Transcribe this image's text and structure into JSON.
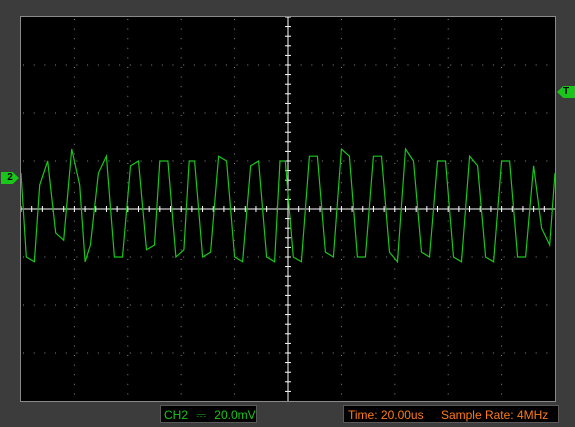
{
  "channel": {
    "marker_label": "2",
    "name": "CH2",
    "coupling_symbol": "⎓",
    "scale": "20.0mV"
  },
  "trigger": {
    "marker_label": "T"
  },
  "timebase": {
    "time_label": "Time: 20.00us",
    "sample_rate_label": "Sample Rate: 4MHz"
  },
  "colors": {
    "trace": "#19c619",
    "grid_dots": "#8a8a8a",
    "axis": "#ffffff",
    "status_orange": "#ff7a1a",
    "background": "#000000"
  },
  "grid": {
    "h_divisions": 10,
    "v_divisions": 8
  },
  "chart_data": {
    "type": "line",
    "title": "",
    "xlabel": "",
    "ylabel": "",
    "x_unit": "us",
    "y_unit": "mV",
    "xlim": [
      0,
      200
    ],
    "ylim": [
      -80,
      80
    ],
    "series": [
      {
        "x": [
          0,
          2,
          5,
          7,
          10,
          13,
          16,
          19,
          22,
          24,
          26,
          29,
          32,
          35,
          38,
          41,
          44,
          47,
          50,
          52,
          55,
          58,
          61,
          63,
          65,
          68,
          71,
          74,
          77,
          80,
          83,
          86,
          89,
          92,
          95,
          97,
          99,
          102,
          105,
          108,
          111,
          114,
          117,
          120,
          123,
          126,
          129,
          132,
          135,
          138,
          141,
          144,
          147,
          150,
          153,
          156,
          159,
          162,
          165,
          168,
          171,
          174,
          177,
          180,
          183,
          186,
          189,
          192,
          195,
          198,
          200
        ],
        "y": [
          15,
          -20,
          -22,
          10,
          20,
          -10,
          -13,
          25,
          10,
          -22,
          -15,
          15,
          22,
          -20,
          -20,
          18,
          20,
          -17,
          -15,
          20,
          20,
          -20,
          -17,
          20,
          20,
          -20,
          -18,
          22,
          20,
          -20,
          -22,
          18,
          20,
          -20,
          -22,
          20,
          20,
          -20,
          -22,
          22,
          22,
          -18,
          -20,
          25,
          22,
          -20,
          -20,
          22,
          22,
          -18,
          -22,
          25,
          20,
          -18,
          -20,
          20,
          20,
          -20,
          -22,
          22,
          18,
          -20,
          -22,
          20,
          20,
          -20,
          -20,
          18,
          -8,
          -15,
          15
        ]
      }
    ]
  }
}
